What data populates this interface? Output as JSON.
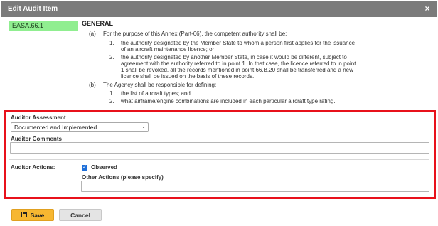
{
  "dialog": {
    "title": "Edit Audit Item",
    "close_glyph": "×"
  },
  "item": {
    "reference": "EASA.66.1",
    "heading": "GENERAL",
    "clauses": [
      {
        "label": "(a)",
        "text": "For the purpose of this Annex (Part-66), the competent authority shall be:"
      },
      {
        "label": "1.",
        "text": "the authority designated by the Member State to whom a person first applies for the issuance"
      },
      {
        "label": "",
        "text": "of an aircraft maintenance licence; or"
      },
      {
        "label": "2.",
        "text": "the authority designated by another Member State, in case it would be different, subject to"
      },
      {
        "label": "",
        "text": "agreement with the authority referred to in point 1. In that case, the licence referred to in point"
      },
      {
        "label": "",
        "text": "1 shall be revoked, all the records mentioned in point 66.B.20 shall be transferred and a new"
      },
      {
        "label": "",
        "text": "licence shall be issued on the basis of these records."
      },
      {
        "label": "(b)",
        "text": "The Agency shall be responsible for defining:"
      },
      {
        "label": "1.",
        "text": "the list of aircraft types; and"
      },
      {
        "label": "2.",
        "text": "what airframe/engine combinations are included in each particular aircraft type rating."
      }
    ]
  },
  "assessment": {
    "label": "Auditor Assessment",
    "selected": "Documented and Implemented",
    "chevron": "⌄"
  },
  "comments": {
    "label": "Auditor Comments",
    "value": ""
  },
  "actions": {
    "label": "Auditor Actions:",
    "observed_label": "Observed",
    "observed_checked": true,
    "check_glyph": "✓",
    "other_label": "Other Actions (please specify)",
    "other_value": ""
  },
  "buttons": {
    "save_label": "Save",
    "save_icon": "floppy-disk-icon",
    "cancel_label": "Cancel"
  },
  "colors": {
    "highlight_border": "#e8111b",
    "reference_badge": "#90ee90",
    "save_button": "#f7b731",
    "checkbox": "#1e6fd9"
  }
}
